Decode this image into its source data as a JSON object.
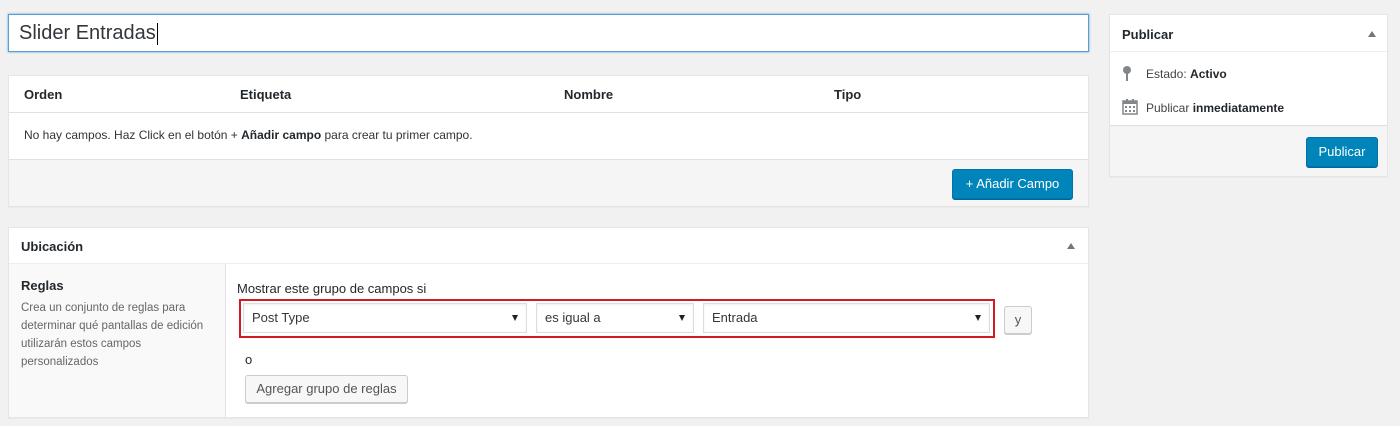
{
  "title_input": {
    "value": "Slider Entradas"
  },
  "fields": {
    "columns": [
      "Orden",
      "Etiqueta",
      "Nombre",
      "Tipo"
    ],
    "empty_message": {
      "before": "No hay campos. Haz Click en el botón",
      "plus": "+",
      "bold": "Añadir campo",
      "after": "para crear tu primer campo."
    },
    "add_button_label": "+ Añadir Campo"
  },
  "location": {
    "title": "Ubicación",
    "rules_label": "Reglas",
    "rules_description": "Crea un conjunto de reglas para determinar qué pantallas de edición utilizarán estos campos personalizados",
    "show_label": "Mostrar este grupo de campos si",
    "rule": {
      "param": "Post Type",
      "operator": "es igual a",
      "value": "Entrada"
    },
    "and_button_label": "y",
    "or_label": "o",
    "add_group_button_label": "Agregar grupo de reglas"
  },
  "publish": {
    "title": "Publicar",
    "status_label": "Estado:",
    "status_value": "Activo",
    "schedule_label": "Publicar",
    "schedule_value": "inmediatamente",
    "button_label": "Publicar"
  },
  "colors": {
    "primary": "#0085ba",
    "highlight_outline": "#d11a24",
    "background": "#f1f1f1"
  },
  "icons": [
    "pin-icon",
    "calendar-icon",
    "collapse-arrow-icon",
    "dropdown-arrow-icon"
  ]
}
